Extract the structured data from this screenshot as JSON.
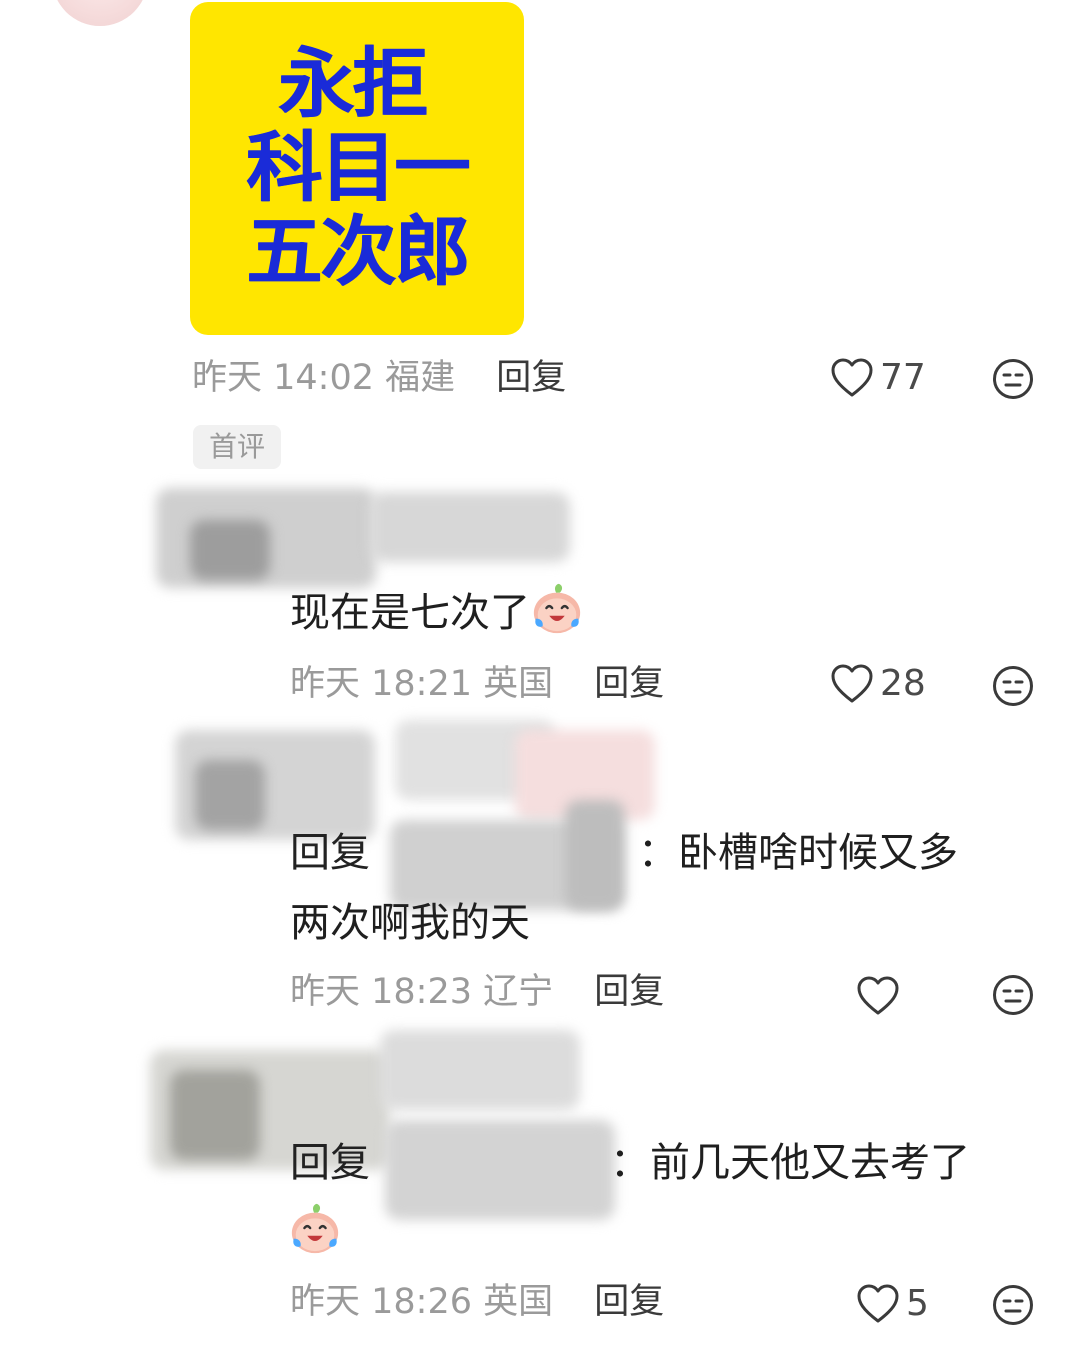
{
  "post": {
    "sticker": {
      "lines": [
        "永拒",
        "科目一",
        "五次郎"
      ],
      "bg_color": "#ffe600",
      "text_color": "#1a2bd8"
    },
    "meta": {
      "time": "昨天 14:02",
      "location": "福建",
      "reply_label": "回复"
    },
    "likes": "77",
    "badge": "首评"
  },
  "replies": [
    {
      "text": "现在是七次了",
      "emoji": "crying-laughing-face",
      "meta": {
        "time": "昨天 18:21",
        "location": "英国",
        "reply_label": "回复"
      },
      "likes": "28"
    },
    {
      "reply_prefix": "回复",
      "text_line1": "：卧槽啥时候又多",
      "text_line2": "两次啊我的天",
      "meta": {
        "time": "昨天 18:23",
        "location": "辽宁",
        "reply_label": "回复"
      },
      "likes": ""
    },
    {
      "reply_prefix": "回复",
      "text_line1": "：前几天他又去考了",
      "emoji": "crying-laughing-face",
      "meta": {
        "time": "昨天 18:26",
        "location": "英国",
        "reply_label": "回复"
      },
      "likes": "5"
    }
  ],
  "colors": {
    "meta_gray": "#9a9a9a",
    "reply_dark": "#3a3a3a",
    "accent_yellow": "#ffe600",
    "accent_blue": "#1a2bd8"
  }
}
